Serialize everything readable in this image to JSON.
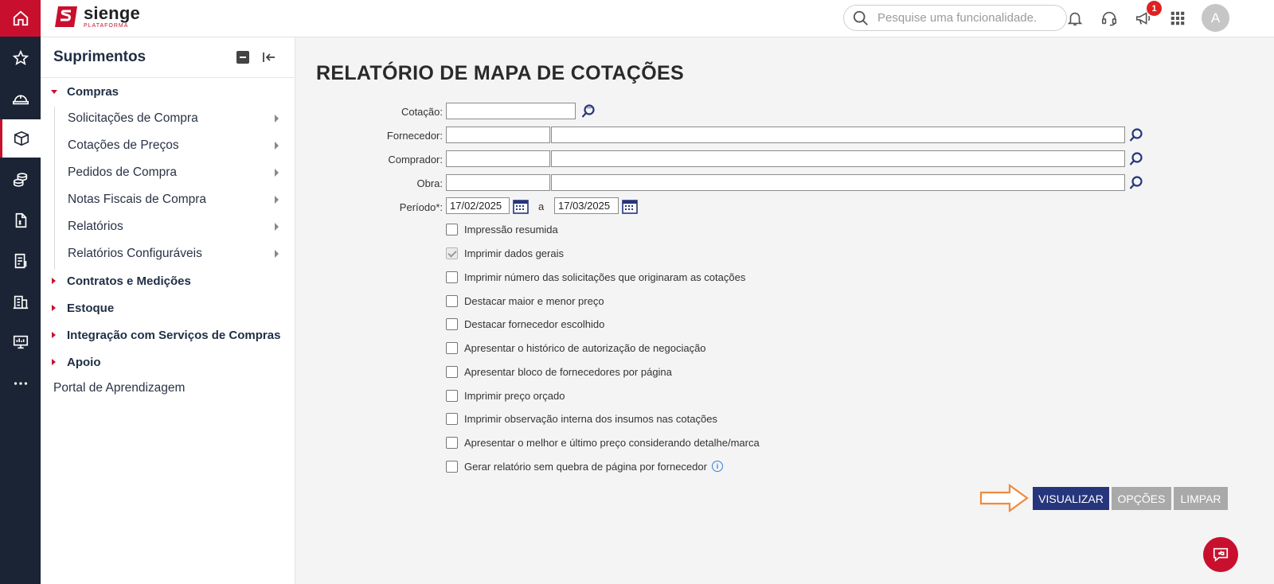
{
  "app": {
    "brand": "sienge",
    "brand_sub": "PLATAFORMA"
  },
  "topbar": {
    "search_placeholder": "Pesquise uma funcionalidade.",
    "notification_count": "1",
    "avatar_initial": "A"
  },
  "rail": {
    "items": [
      "home-icon",
      "star-icon",
      "helmet-icon",
      "box-icon",
      "coins-icon",
      "document-icon",
      "report-icon",
      "building-icon",
      "monitor-icon",
      "more-icon"
    ]
  },
  "sidebar": {
    "title": "Suprimentos",
    "groups": [
      {
        "label": "Compras",
        "expanded": true
      },
      {
        "label": "Contratos e Medições",
        "expanded": false
      },
      {
        "label": "Estoque",
        "expanded": false
      },
      {
        "label": "Integração com Serviços de Compras",
        "expanded": false
      },
      {
        "label": "Apoio",
        "expanded": false
      }
    ],
    "compras_items": [
      "Solicitações de Compra",
      "Cotações de Preços",
      "Pedidos de Compra",
      "Notas Fiscais de Compra",
      "Relatórios",
      "Relatórios Configuráveis"
    ],
    "portal": "Portal de Aprendizagem"
  },
  "form": {
    "title": "RELATÓRIO DE MAPA DE COTAÇÕES",
    "cotacao_label": "Cotação:",
    "fornecedor_label": "Fornecedor:",
    "comprador_label": "Comprador:",
    "obra_label": "Obra:",
    "periodo_label": "Período*:",
    "periodo_start": "17/02/2025",
    "periodo_sep": "a",
    "periodo_end": "17/03/2025",
    "options": [
      {
        "label": "Impressão resumida",
        "checked": false
      },
      {
        "label": "Imprimir dados gerais",
        "checked": true
      },
      {
        "label": "Imprimir número das solicitações que originaram as cotações",
        "checked": false
      },
      {
        "label": "Destacar maior e menor preço",
        "checked": false
      },
      {
        "label": "Destacar fornecedor escolhido",
        "checked": false
      },
      {
        "label": "Apresentar o histórico de autorização de negociação",
        "checked": false
      },
      {
        "label": "Apresentar bloco de fornecedores por página",
        "checked": false
      },
      {
        "label": "Imprimir preço orçado",
        "checked": false
      },
      {
        "label": "Imprimir observação interna dos insumos nas cotações",
        "checked": false
      },
      {
        "label": "Apresentar o melhor e último preço considerando detalhe/marca",
        "checked": false
      },
      {
        "label": "Gerar relatório sem quebra de página por fornecedor",
        "checked": false
      }
    ],
    "buttons": {
      "visualizar": "VISUALIZAR",
      "opcoes": "OPÇÕES",
      "limpar": "LIMPAR"
    }
  },
  "colors": {
    "brand_red": "#c8102e",
    "rail_bg": "#1b2434",
    "primary_button": "#27357c",
    "secondary_button": "#a9a9a9",
    "arrow": "#f08a3c"
  }
}
